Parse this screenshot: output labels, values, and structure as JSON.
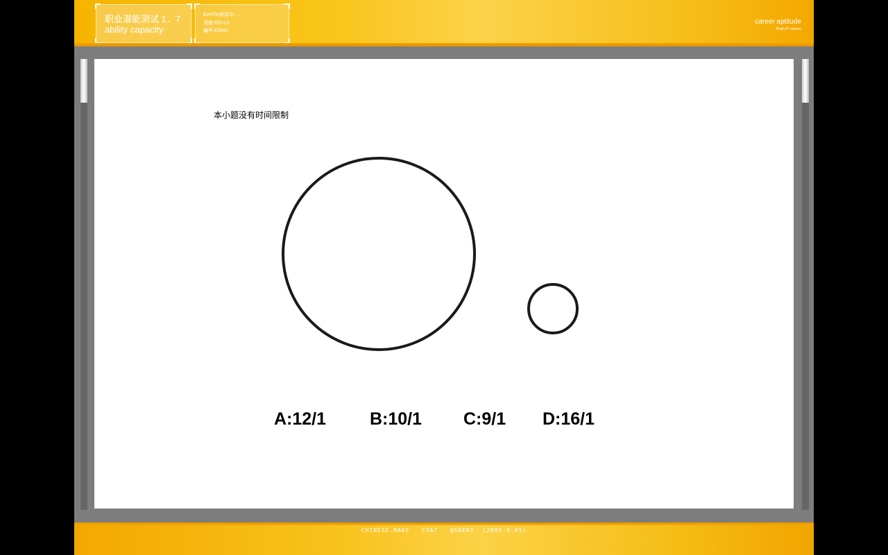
{
  "header": {
    "title": "职业潜能测试 1．7",
    "subtitle": "ability capacity",
    "info_line1": "EortTle测试中......",
    "info_line2": "进度:8/3>13",
    "info_line3": "编号:E0841",
    "brand": "career aptitude",
    "brand_sub": "Brain AT system"
  },
  "question": {
    "note": "本小题没有时间限制",
    "options": [
      "A:12/1",
      "B:10/1",
      "C:9/1",
      "D:16/1"
    ]
  },
  "footer": {
    "text": "CHINESE.MAKE   COAT   @SDERT  (2005.9.05)"
  },
  "colors": {
    "accent": "#f7be14",
    "panel": "#7d7d7d"
  }
}
